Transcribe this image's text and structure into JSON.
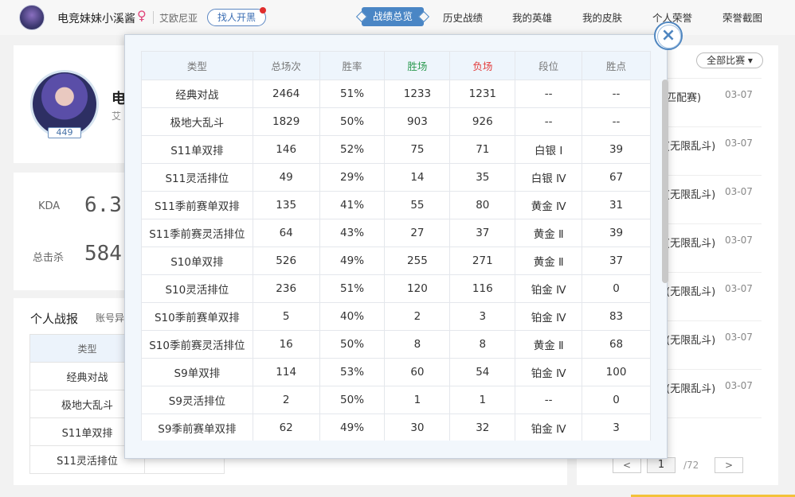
{
  "header": {
    "username": "电竞妹妹小溪酱",
    "gender_symbol": "♀",
    "server": "艾欧尼亚",
    "find_button": "找人开黑",
    "nav": [
      "战绩总览",
      "历史战绩",
      "我的英雄",
      "我的皮肤",
      "个人荣誉",
      "荣誉截图"
    ]
  },
  "profile": {
    "name_partial": "电",
    "server_partial": "艾",
    "level": "449"
  },
  "stats": [
    {
      "label": "KDA",
      "value": "6.3"
    },
    {
      "label": "总击杀",
      "value": "584"
    }
  ],
  "section": {
    "title": "个人战报",
    "sub": "账号异"
  },
  "background_table": {
    "header": "类型",
    "rows": [
      "经典对战",
      "极地大乱斗",
      "S11单双排",
      "S11灵活排位"
    ]
  },
  "matches": {
    "filter": "全部比赛",
    "items": [
      {
        "text": "匹配赛)",
        "date": "03-07"
      },
      {
        "text": "(无限乱斗)",
        "date": "03-07"
      },
      {
        "text": "(无限乱斗)",
        "date": "03-07"
      },
      {
        "text": "(无限乱斗)",
        "date": "03-07"
      },
      {
        "text": "(无限乱斗)",
        "date": "03-07"
      },
      {
        "text": "(无限乱斗)",
        "date": "03-07"
      },
      {
        "text": "(无限乱斗)",
        "date": "03-07"
      }
    ]
  },
  "pager": {
    "prev": "<",
    "current": "1",
    "total": "/72",
    "next": ">"
  },
  "modal": {
    "close": "×",
    "columns": [
      "类型",
      "总场次",
      "胜率",
      "胜场",
      "负场",
      "段位",
      "胜点"
    ],
    "rows": [
      [
        "经典对战",
        "2464",
        "51%",
        "1233",
        "1231",
        "--",
        "--"
      ],
      [
        "极地大乱斗",
        "1829",
        "50%",
        "903",
        "926",
        "--",
        "--"
      ],
      [
        "S11单双排",
        "146",
        "52%",
        "75",
        "71",
        "白银 Ⅰ",
        "39"
      ],
      [
        "S11灵活排位",
        "49",
        "29%",
        "14",
        "35",
        "白银 Ⅳ",
        "67"
      ],
      [
        "S11季前赛单双排",
        "135",
        "41%",
        "55",
        "80",
        "黄金 Ⅳ",
        "31"
      ],
      [
        "S11季前赛灵活排位",
        "64",
        "43%",
        "27",
        "37",
        "黄金 Ⅱ",
        "39"
      ],
      [
        "S10单双排",
        "526",
        "49%",
        "255",
        "271",
        "黄金 Ⅱ",
        "37"
      ],
      [
        "S10灵活排位",
        "236",
        "51%",
        "120",
        "116",
        "铂金 Ⅳ",
        "0"
      ],
      [
        "S10季前赛单双排",
        "5",
        "40%",
        "2",
        "3",
        "铂金 Ⅳ",
        "83"
      ],
      [
        "S10季前赛灵活排位",
        "16",
        "50%",
        "8",
        "8",
        "黄金 Ⅱ",
        "68"
      ],
      [
        "S9单双排",
        "114",
        "53%",
        "60",
        "54",
        "铂金 Ⅳ",
        "100"
      ],
      [
        "S9灵活排位",
        "2",
        "50%",
        "1",
        "1",
        "--",
        "0"
      ],
      [
        "S9季前赛单双排",
        "62",
        "49%",
        "30",
        "32",
        "铂金 Ⅳ",
        "3"
      ]
    ]
  }
}
